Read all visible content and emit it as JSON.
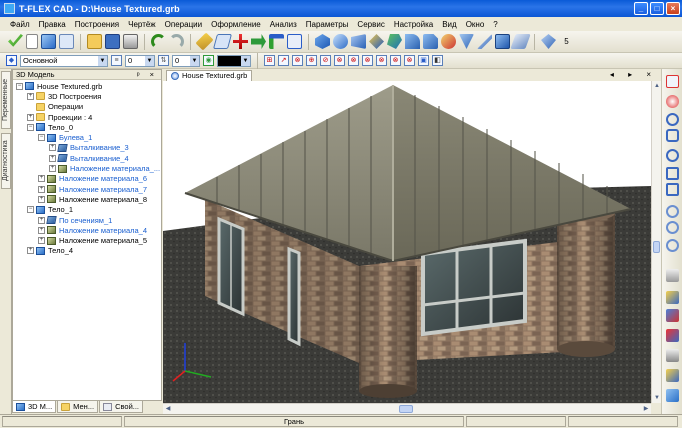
{
  "window": {
    "title": "T-FLEX CAD - D:\\House Textured.grb",
    "controls": {
      "minimize": "_",
      "maximize": "□",
      "close": "×"
    }
  },
  "menu": [
    "Файл",
    "Правка",
    "Построения",
    "Чертёж",
    "Операции",
    "Оформление",
    "Анализ",
    "Параметры",
    "Сервис",
    "Настройка",
    "Вид",
    "Окно",
    "?"
  ],
  "toolbar2": {
    "layer_value": "Основной",
    "field1_value": "0",
    "field2_value": "0",
    "zoom_label": "5"
  },
  "left_vertical_tabs": [
    "Переменные",
    "Диагностика"
  ],
  "model_panel": {
    "title": "3D Модель",
    "header_buttons": "ᵖ ×",
    "tree": [
      {
        "label": "House Textured.grb",
        "indent": 0,
        "icon": "cube",
        "expander": "−",
        "color": "normal"
      },
      {
        "label": "3D Построения",
        "indent": 1,
        "icon": "folder",
        "expander": "+",
        "color": "normal"
      },
      {
        "label": "Операции",
        "indent": 1,
        "icon": "folder",
        "expander": "",
        "color": "normal"
      },
      {
        "label": "Проекции : 4",
        "indent": 1,
        "icon": "folder",
        "expander": "+",
        "color": "normal"
      },
      {
        "label": "Тело_0",
        "indent": 1,
        "icon": "cube",
        "expander": "−",
        "color": "normal"
      },
      {
        "label": "Булева_1",
        "indent": 2,
        "icon": "cube",
        "expander": "−",
        "color": "blue"
      },
      {
        "label": "Выталкивание_3",
        "indent": 3,
        "icon": "feat",
        "expander": "+",
        "color": "blue"
      },
      {
        "label": "Выталкивание_4",
        "indent": 3,
        "icon": "feat",
        "expander": "+",
        "color": "blue"
      },
      {
        "label": "Наложение материала_...",
        "indent": 3,
        "icon": "mat",
        "expander": "+",
        "color": "blue"
      },
      {
        "label": "Наложение материала_6",
        "indent": 2,
        "icon": "mat",
        "expander": "+",
        "color": "blue"
      },
      {
        "label": "Наложение материала_7",
        "indent": 2,
        "icon": "mat",
        "expander": "+",
        "color": "blue"
      },
      {
        "label": "Наложение материала_8",
        "indent": 2,
        "icon": "mat",
        "expander": "+",
        "color": "normal"
      },
      {
        "label": "Тело_1",
        "indent": 1,
        "icon": "cube",
        "expander": "−",
        "color": "normal"
      },
      {
        "label": "По сечениям_1",
        "indent": 2,
        "icon": "feat",
        "expander": "+",
        "color": "blue"
      },
      {
        "label": "Наложение материала_4",
        "indent": 2,
        "icon": "mat",
        "expander": "+",
        "color": "blue"
      },
      {
        "label": "Наложение материала_5",
        "indent": 2,
        "icon": "mat",
        "expander": "+",
        "color": "normal"
      },
      {
        "label": "Тело_4",
        "indent": 1,
        "icon": "cube",
        "expander": "+",
        "color": "normal"
      }
    ]
  },
  "panel_tabs": [
    "3D М...",
    "Мен...",
    "Свой..."
  ],
  "document": {
    "tab_label": "House Textured.grb",
    "tab_controls": "◂ ▸ ×"
  },
  "status": {
    "main": "Грань"
  },
  "colors": {
    "titlebar": "#0a5ad7",
    "selection_text": "#1a5fd0",
    "roof": "#8a8a78",
    "brick": "#9a806a",
    "ground": "#3a3a36"
  }
}
